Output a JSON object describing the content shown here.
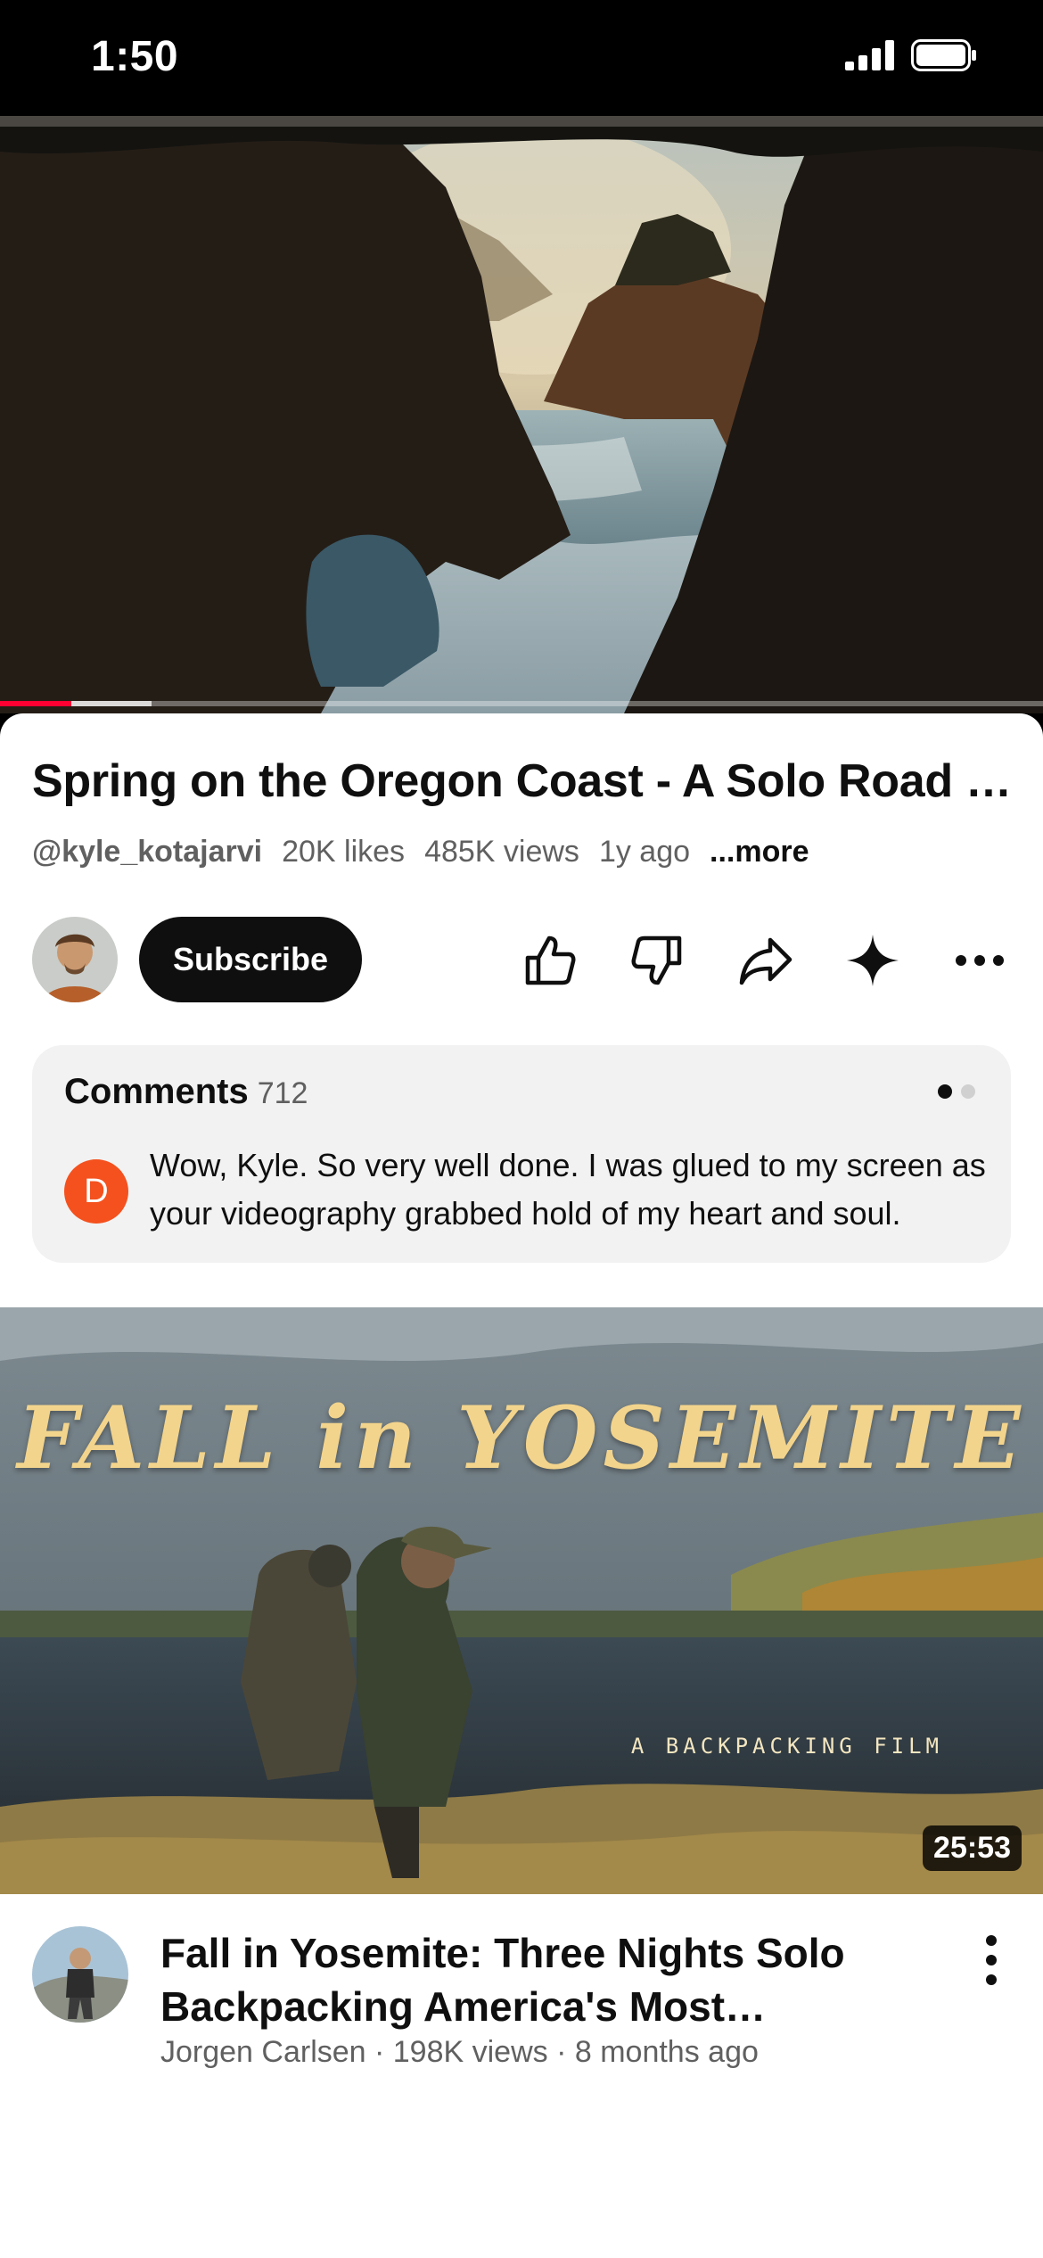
{
  "status_bar": {
    "time": "1:50"
  },
  "player": {
    "progress_fraction": 0.068,
    "buffered_fraction": 0.145
  },
  "video": {
    "title": "Spring on the Oregon Coast - A Solo Road Trip",
    "channel_handle": "@kyle_kotajarvi",
    "likes": "20K likes",
    "views": "485K views",
    "age": "1y ago",
    "more_label": "...more"
  },
  "actions": {
    "subscribe_label": "Subscribe",
    "icons": [
      "like-icon",
      "dislike-icon",
      "share-icon",
      "sparkle-icon",
      "more-icon"
    ]
  },
  "comments": {
    "label": "Comments",
    "count": "712",
    "avatar_initial": "D",
    "avatar_color": "#f4511e",
    "preview_text": "Wow, Kyle.  So very well done.  I was glued to my screen as your videography grabbed hold of my heart and soul."
  },
  "next_video": {
    "thumbnail_title": "FALL in YOSEMITE",
    "thumbnail_subtitle": "A BACKPACKING FILM",
    "duration": "25:53",
    "title": "Fall in Yosemite: Three Nights Solo Backpacking America's Most Beautiful Park",
    "meta": "Jorgen Carlsen · 198K views · 8 months ago"
  },
  "colors": {
    "accent": "#ff0033",
    "subscribe_bg": "#0f0f0f",
    "card_bg": "#f2f2f2",
    "thumb_title": "#f3d48c"
  }
}
